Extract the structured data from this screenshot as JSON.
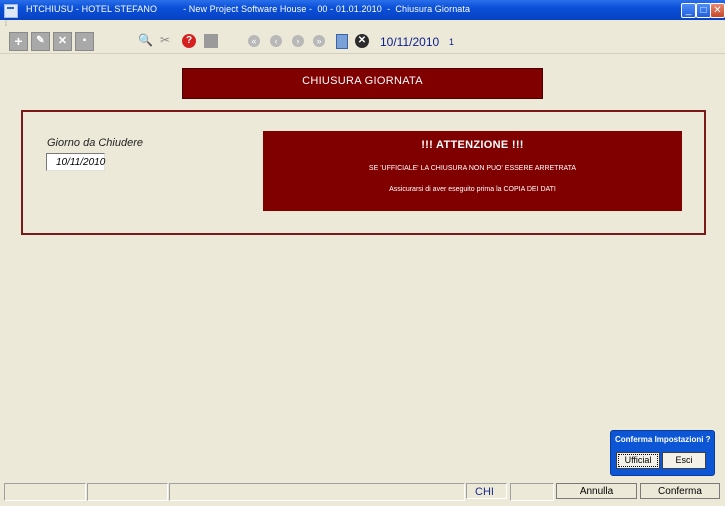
{
  "window": {
    "title": "HTCHIUSU - HOTEL STEFANO          - New Project Software House -  00 - 01.01.2010  -  Chiusura Giornata",
    "minimize_glyph": "_",
    "maximize_glyph": "□",
    "close_glyph": "✕"
  },
  "menubar": {
    "grip": "⁞"
  },
  "toolbar": {
    "icons": {
      "new": "+",
      "edit": "✎",
      "delete": "✕",
      "save": "▪",
      "search": "🔍",
      "tools": "✂",
      "help": "?",
      "disk": "",
      "first": "«",
      "prev": "‹",
      "next": "›",
      "last": "»",
      "calc": "",
      "stop": "✕"
    },
    "date": "10/11/2010",
    "counter": "1"
  },
  "header": {
    "title": "CHIUSURA GIORNATA"
  },
  "form": {
    "date_label": "Giorno da Chiudere",
    "date_value": "10/11/2010"
  },
  "alert": {
    "title": "!!! ATTENZIONE !!!",
    "line1": "SE 'UFFICIALE' LA CHIUSURA NON PUO' ESSERE ARRETRATA",
    "line2": "Assicurarsi di aver eseguito prima la COPIA DEI DATI"
  },
  "popup": {
    "title": "Conferma Impostazioni ?",
    "ufficiale_label": "Ufficial",
    "esci_label": "Esci"
  },
  "statusbar": {
    "cell1": "",
    "cell2": "",
    "cell3": "",
    "code": "CHI",
    "cell5": "",
    "annulla_label": "Annulla",
    "conferma_label": "Conferma"
  },
  "colors": {
    "accent": "#800000",
    "window_bg": "#ECE9D8",
    "titlebar": "#0a4fd8",
    "toolbar_text": "#0a1e8c"
  }
}
